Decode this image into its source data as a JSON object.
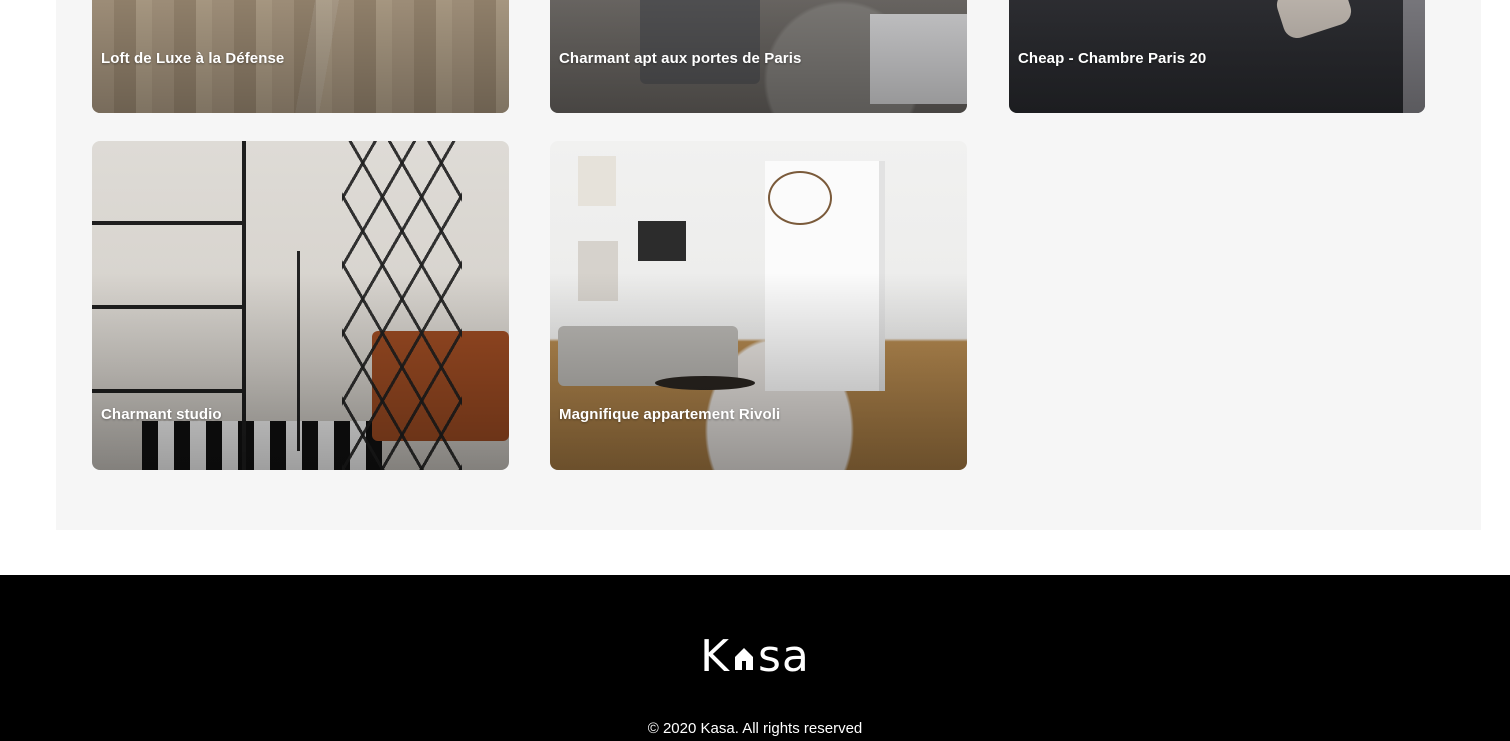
{
  "listings": [
    {
      "title": "Loft de Luxe à la Défense"
    },
    {
      "title": "Charmant apt aux portes de Paris"
    },
    {
      "title": "Cheap - Chambre Paris 20"
    },
    {
      "title": "Charmant studio"
    },
    {
      "title": "Magnifique appartement Rivoli"
    }
  ],
  "footer": {
    "logo_left": "K",
    "logo_right": "sa",
    "copyright": "© 2020 Kasa. All rights reserved"
  }
}
